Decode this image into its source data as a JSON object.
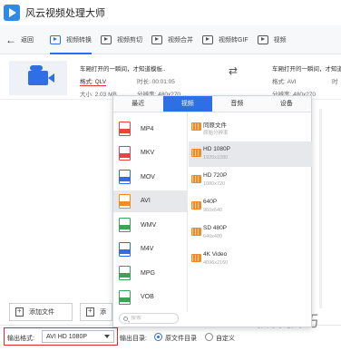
{
  "app": {
    "title": "风云视频处理大师"
  },
  "toolbar": {
    "back_label": "返回",
    "items": [
      {
        "label": "视频转换",
        "active": true
      },
      {
        "label": "视频剪切"
      },
      {
        "label": "视频合并"
      },
      {
        "label": "视频转GIF"
      },
      {
        "label": "视频"
      }
    ]
  },
  "file": {
    "name": "车厢打开的一瞬间，才知道模板..",
    "format": "格式: QLV",
    "duration": "时长: 00:01:05",
    "size": "大小: 2.03 MB",
    "resolution": "分辨率: 480x270",
    "out_name": "车厢打开的一瞬间，才知道模",
    "out_format": "格式: AVI",
    "out_duration": "时",
    "out_resolution": "分辨率: 480x270"
  },
  "dropdown": {
    "tabs": [
      "最近",
      "视频",
      "音频",
      "设备"
    ],
    "active_tab": "视频",
    "formats": [
      {
        "name": "MP4",
        "tag": "MP4",
        "color": "#e8463a"
      },
      {
        "name": "MKV",
        "tag": "MKV",
        "color": "#e8463a"
      },
      {
        "name": "MOV",
        "tag": "MOV",
        "color": "#2e6fe6"
      },
      {
        "name": "AVI",
        "tag": "AVI",
        "color": "#f08c28",
        "active": true
      },
      {
        "name": "WMV",
        "tag": "WMV",
        "color": "#3aa655"
      },
      {
        "name": "M4V",
        "tag": "M4V",
        "color": "#2e6fe6"
      },
      {
        "name": "MPG",
        "tag": "MPG",
        "color": "#3aa655"
      },
      {
        "name": "VOB",
        "tag": "VOB",
        "color": "#3aa655"
      }
    ],
    "qualities": [
      {
        "title": "同原文件",
        "sub": "原始分辨率"
      },
      {
        "title": "HD 1080P",
        "sub": "1920x1080",
        "active": true
      },
      {
        "title": "HD 720P",
        "sub": "1080x720"
      },
      {
        "title": "640P",
        "sub": "960x640"
      },
      {
        "title": "SD 480P",
        "sub": "640x480"
      },
      {
        "title": "4K Video",
        "sub": "4096x2160"
      }
    ],
    "search_placeholder": "搜索"
  },
  "bottom": {
    "add_file": "添加文件",
    "add_file2": "添",
    "edge_text": "添",
    "output_format_label": "输出格式:",
    "output_format_value": "AVI HD 1080P",
    "output_dir_label": "输出目录:",
    "radio_source": "原文件目录",
    "radio_custom": "自定义"
  },
  "watermark": "软件技巧"
}
